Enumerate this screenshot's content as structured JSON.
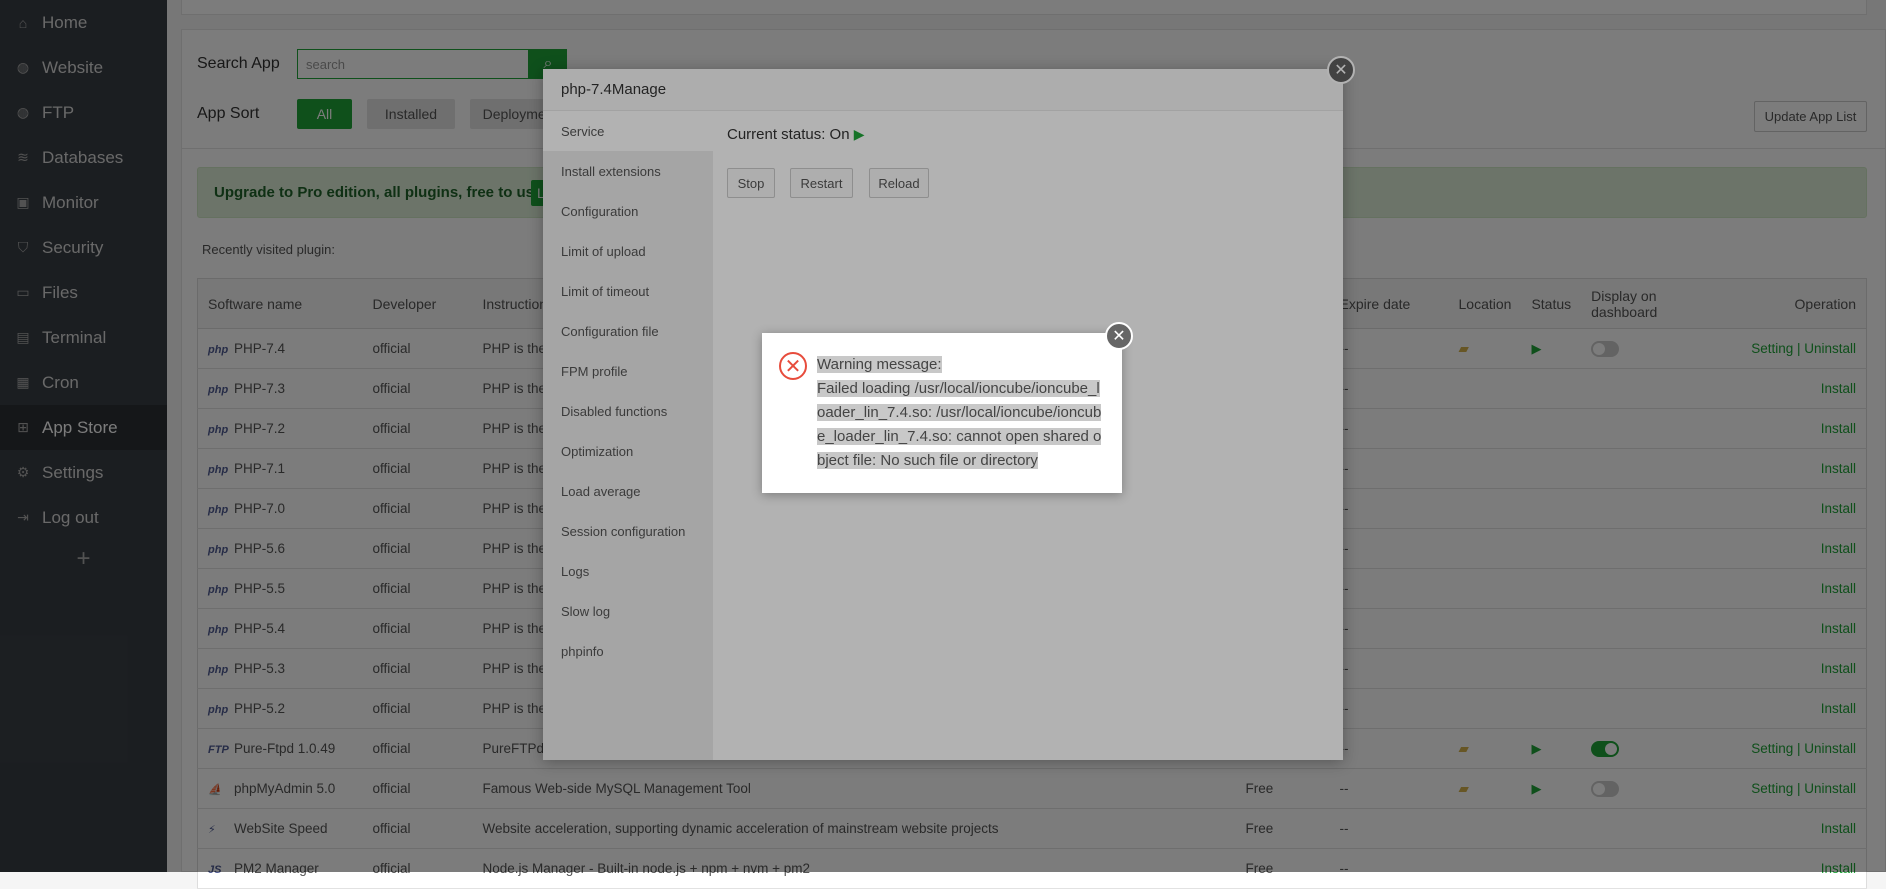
{
  "sidebar": {
    "items": [
      {
        "label": "Home",
        "icon": "home-icon",
        "glyph": "⌂"
      },
      {
        "label": "Website",
        "icon": "globe-icon",
        "glyph": "◍"
      },
      {
        "label": "FTP",
        "icon": "ftp-icon",
        "glyph": "◍"
      },
      {
        "label": "Databases",
        "icon": "database-icon",
        "glyph": "≋"
      },
      {
        "label": "Monitor",
        "icon": "monitor-icon",
        "glyph": "▣"
      },
      {
        "label": "Security",
        "icon": "shield-icon",
        "glyph": "⛉"
      },
      {
        "label": "Files",
        "icon": "folder-icon",
        "glyph": "▭"
      },
      {
        "label": "Terminal",
        "icon": "terminal-icon",
        "glyph": "▤"
      },
      {
        "label": "Cron",
        "icon": "calendar-icon",
        "glyph": "▦"
      },
      {
        "label": "App Store",
        "icon": "apps-icon",
        "glyph": "⊞",
        "active": true
      },
      {
        "label": "Settings",
        "icon": "gear-icon",
        "glyph": "⚙"
      },
      {
        "label": "Log out",
        "icon": "logout-icon",
        "glyph": "⇥"
      }
    ],
    "add": "+"
  },
  "toolbar": {
    "search_label": "Search App",
    "search_placeholder": "search",
    "sort_label": "App Sort",
    "sorts": [
      "All",
      "Installed",
      "Deployment"
    ],
    "update_label": "Update App List"
  },
  "banner": {
    "text": "Upgrade to Pro edition, all plugins, free to use!",
    "button": "L"
  },
  "recent_label": "Recently visited plugin:",
  "table": {
    "headers": [
      "Software name",
      "Developer",
      "Instruction",
      "",
      "Expire date",
      "Location",
      "Status",
      "Display on dashboard",
      "Operation"
    ],
    "rows": [
      {
        "icon": "php",
        "name": "PHP-7.4",
        "dev": "official",
        "desc": "PHP is the",
        "price": "",
        "expire": "--",
        "installed": true,
        "display": false,
        "op": "Setting | Uninstall"
      },
      {
        "icon": "php",
        "name": "PHP-7.3",
        "dev": "official",
        "desc": "PHP is the",
        "price": "",
        "expire": "--",
        "op": "Install"
      },
      {
        "icon": "php",
        "name": "PHP-7.2",
        "dev": "official",
        "desc": "PHP is the",
        "price": "",
        "expire": "--",
        "op": "Install"
      },
      {
        "icon": "php",
        "name": "PHP-7.1",
        "dev": "official",
        "desc": "PHP is the",
        "price": "",
        "expire": "--",
        "op": "Install"
      },
      {
        "icon": "php",
        "name": "PHP-7.0",
        "dev": "official",
        "desc": "PHP is the",
        "price": "",
        "expire": "--",
        "op": "Install"
      },
      {
        "icon": "php",
        "name": "PHP-5.6",
        "dev": "official",
        "desc": "PHP is the",
        "price": "",
        "expire": "--",
        "op": "Install"
      },
      {
        "icon": "php",
        "name": "PHP-5.5",
        "dev": "official",
        "desc": "PHP is the",
        "price": "",
        "expire": "--",
        "op": "Install"
      },
      {
        "icon": "php",
        "name": "PHP-5.4",
        "dev": "official",
        "desc": "PHP is the",
        "price": "",
        "expire": "--",
        "op": "Install"
      },
      {
        "icon": "php",
        "name": "PHP-5.3",
        "dev": "official",
        "desc": "PHP is the",
        "price": "",
        "expire": "--",
        "op": "Install"
      },
      {
        "icon": "php",
        "name": "PHP-5.2",
        "dev": "official",
        "desc": "PHP is the",
        "price": "",
        "expire": "--",
        "op": "Install"
      },
      {
        "icon": "FTP",
        "name": "Pure-Ftpd 1.0.49",
        "dev": "official",
        "desc": "PureFTPd i",
        "price": "",
        "expire": "--",
        "installed": true,
        "display": true,
        "op": "Setting | Uninstall"
      },
      {
        "icon": "⛵",
        "name": "phpMyAdmin 5.0",
        "dev": "official",
        "desc": "Famous Web-side MySQL Management Tool",
        "price": "Free",
        "expire": "--",
        "installed": true,
        "display": false,
        "op": "Setting | Uninstall"
      },
      {
        "icon": "⚡",
        "name": "WebSite Speed",
        "dev": "official",
        "desc": "Website acceleration, supporting dynamic acceleration of mainstream website projects",
        "price": "Free",
        "expire": "--",
        "op": "Install"
      },
      {
        "icon": "JS",
        "name": "PM2 Manager",
        "dev": "official",
        "desc": "Node.js Manager - Built-in node.js + npm + nvm + pm2",
        "price": "Free",
        "expire": "--",
        "op": "Install"
      }
    ]
  },
  "modal": {
    "title": "php-7.4Manage",
    "close": "✕",
    "nav": [
      "Service",
      "Install extensions",
      "Configuration",
      "Limit of upload",
      "Limit of timeout",
      "Configuration file",
      "FPM profile",
      "Disabled functions",
      "Optimization",
      "Load average",
      "Session configuration",
      "Logs",
      "Slow log",
      "phpinfo"
    ],
    "status_label": "Current status:",
    "status_value": "On",
    "buttons": [
      "Stop",
      "Restart",
      "Reload"
    ]
  },
  "error": {
    "title": "Warning message:",
    "message": "Failed loading /usr/local/ioncube/ioncube_loader_lin_7.4.so: /usr/local/ioncube/ioncube_loader_lin_7.4.so: cannot open shared object file: No such file or directory",
    "close": "✕"
  },
  "colors": {
    "accent": "#20a53a",
    "error": "#e74c3c"
  }
}
